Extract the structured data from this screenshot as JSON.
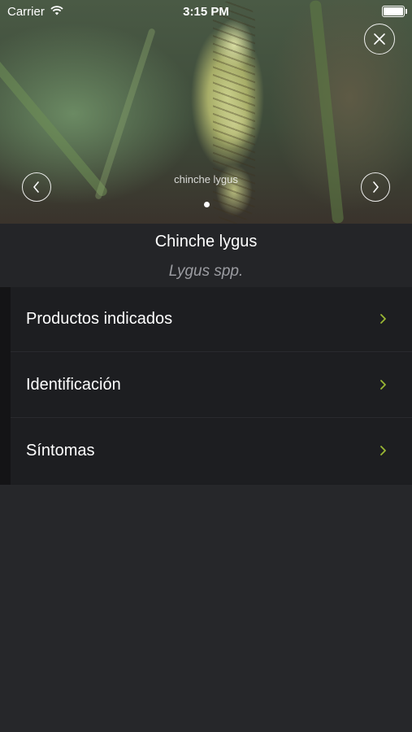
{
  "status_bar": {
    "carrier": "Carrier",
    "time": "3:15 PM"
  },
  "gallery": {
    "caption": "chinche lygus",
    "page_index": 1,
    "page_count": 1
  },
  "header": {
    "title": "Chinche lygus",
    "scientific_name": "Lygus spp."
  },
  "menu": {
    "items": [
      {
        "label": "Productos indicados"
      },
      {
        "label": "Identificación"
      },
      {
        "label": "Síntomas"
      }
    ]
  },
  "colors": {
    "accent": "#9bb834",
    "background": "#242528",
    "row": "#1d1e21",
    "secondary_text": "#9b9ca1"
  }
}
